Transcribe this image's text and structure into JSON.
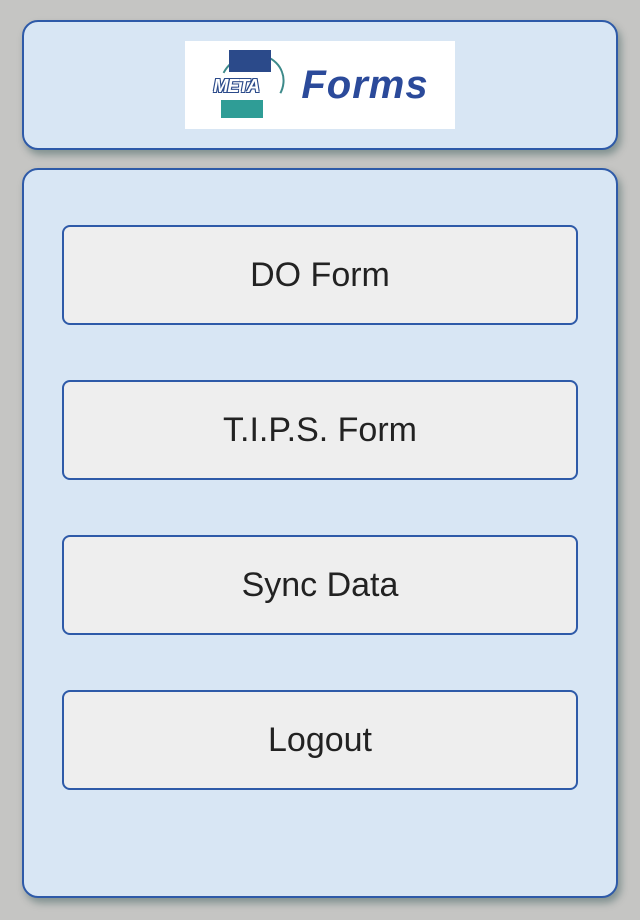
{
  "logo": {
    "meta_text": "META",
    "forms_text": "Forms"
  },
  "menu": {
    "buttons": [
      {
        "label": "DO Form"
      },
      {
        "label": "T.I.P.S. Form"
      },
      {
        "label": "Sync Data"
      },
      {
        "label": "Logout"
      }
    ]
  }
}
